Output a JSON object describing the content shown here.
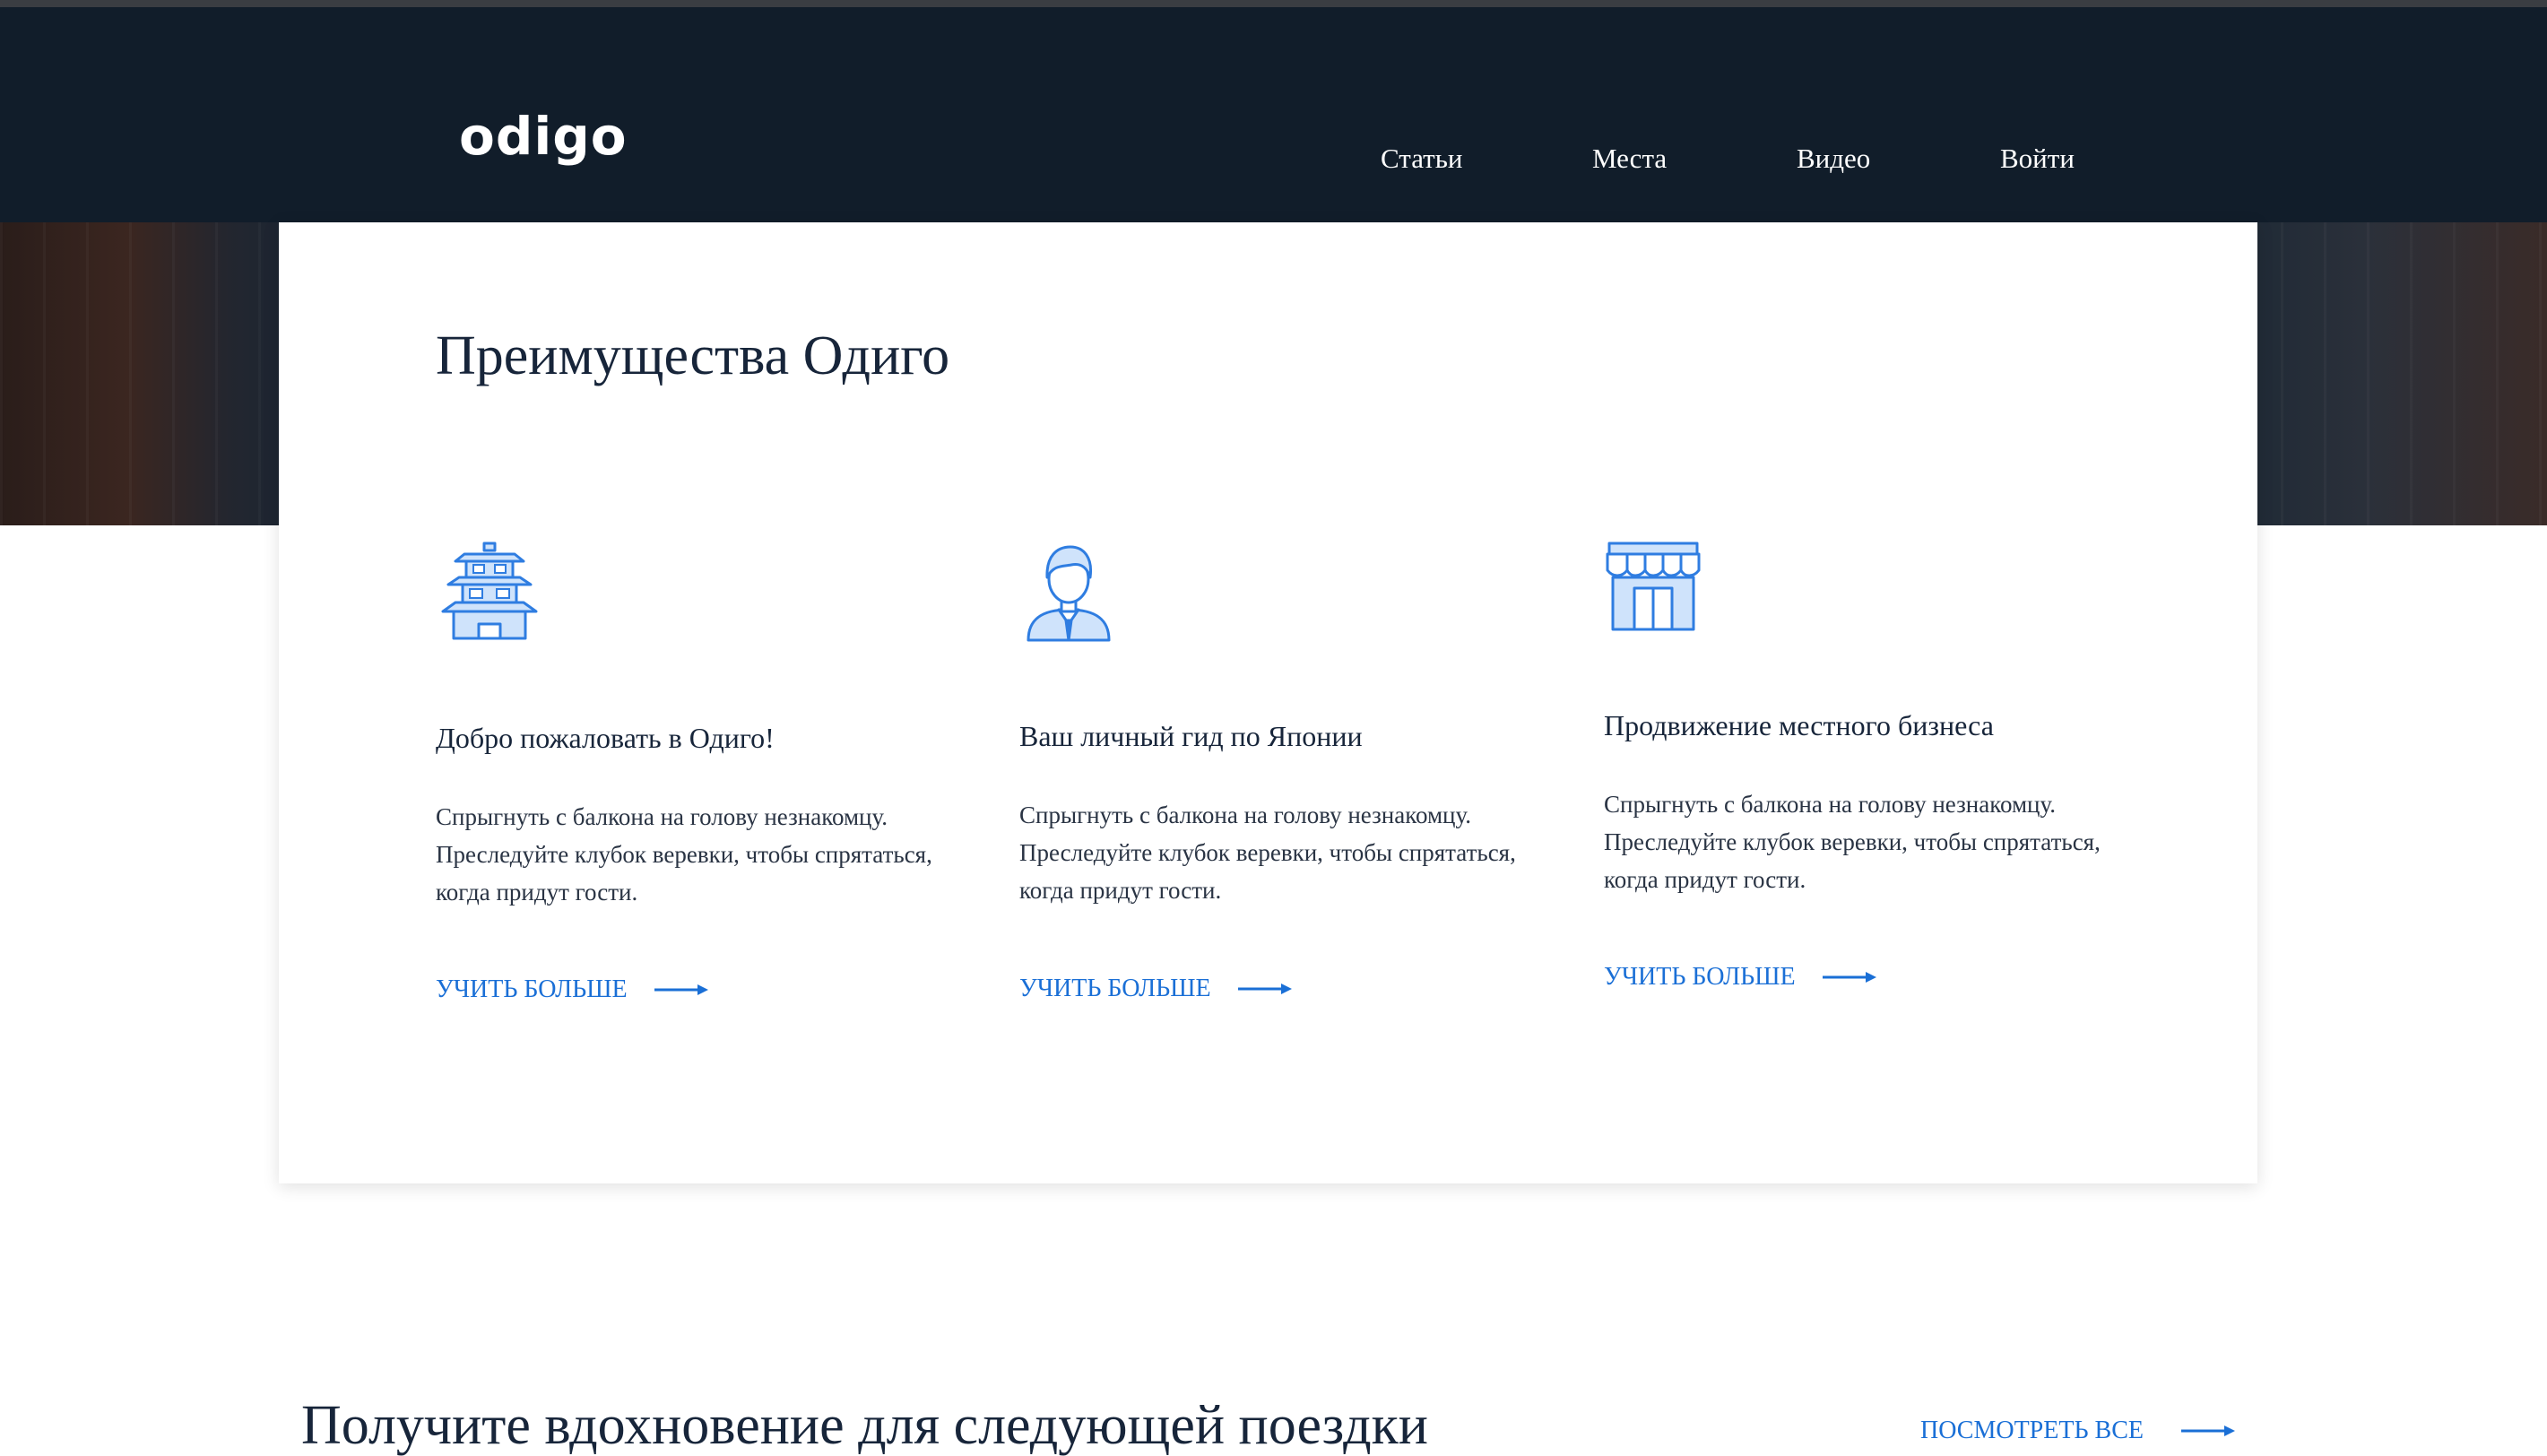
{
  "header": {
    "logo": "odigo",
    "nav": [
      {
        "label": "Статьи"
      },
      {
        "label": "Места"
      },
      {
        "label": "Видео"
      },
      {
        "label": "Войти"
      }
    ]
  },
  "benefits": {
    "title": "Преимущества Одиго",
    "features": [
      {
        "icon": "pagoda-icon",
        "title": "Добро пожаловать в Одиго!",
        "text": "Спрыгнуть с балкона на голову незнакомцу. Преследуйте клубок веревки, чтобы спрятаться, когда придут гости.",
        "link": "УЧИТЬ БОЛЬШЕ"
      },
      {
        "icon": "person-guide-icon",
        "title": "Ваш личный гид по Японии",
        "text": "Спрыгнуть с балкона на голову незнакомцу. Преследуйте клубок веревки, чтобы спрятаться, когда придут гости.",
        "link": "УЧИТЬ БОЛЬШЕ"
      },
      {
        "icon": "storefront-icon",
        "title": "Продвижение местного бизнеса",
        "text": "Спрыгнуть с балкона на голову незнакомцу. Преследуйте клубок веревки, чтобы спрятаться, когда придут гости.",
        "link": "УЧИТЬ БОЛЬШЕ"
      }
    ]
  },
  "inspiration": {
    "title": "Получите вдохновение для следующей поездки",
    "view_all": "ПОСМОТРЕТЬ ВСЕ"
  },
  "colors": {
    "header_bg": "#111d2a",
    "accent": "#1a6fd6",
    "text_dark": "#17253a"
  }
}
